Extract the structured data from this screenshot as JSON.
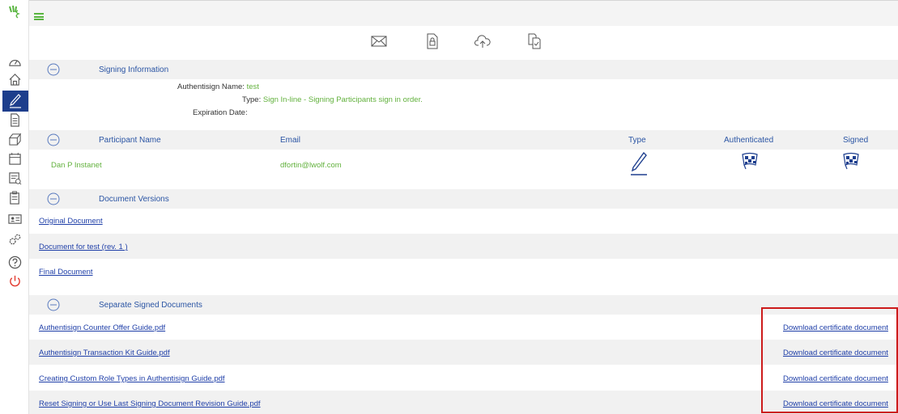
{
  "colors": {
    "accent_green": "#62b13d",
    "link_blue": "#1f3fa8",
    "header_blue": "#2b55a4",
    "nav_active": "#1d3e8c",
    "highlight_red": "#cc1b1b"
  },
  "nav": {
    "icons": [
      "dashboard-icon",
      "home-icon",
      "pen-icon",
      "document-icon",
      "inbox-icon",
      "calendar-icon",
      "search-document-icon",
      "clipboard-icon",
      "contact-card-icon",
      "settings-icon",
      "help-icon",
      "power-icon"
    ]
  },
  "toolbar": {
    "icons": [
      "envelope-icon",
      "locked-document-icon",
      "cloud-upload-icon",
      "copy-document-icon"
    ]
  },
  "signing_info": {
    "title": "Signing Information",
    "name_label": "Authentisign Name:",
    "name_value": "test",
    "type_label": "Type:",
    "type_value": "Sign In-line - Signing Participants sign in order.",
    "expiration_label": "Expiration Date:",
    "expiration_value": ""
  },
  "participants": {
    "headers": {
      "name": "Participant Name",
      "email": "Email",
      "type": "Type",
      "authenticated": "Authenticated",
      "signed": "Signed"
    },
    "rows": [
      {
        "name": "Dan P Instanet",
        "email": "dfortin@lwolf.com",
        "type_icon": "pen-icon",
        "authenticated_icon": "checkered-flag-icon",
        "signed_icon": "checkered-flag-icon"
      }
    ]
  },
  "versions": {
    "title": "Document Versions",
    "items": [
      "Original Document",
      "Document for test (rev. 1 )",
      "Final Document"
    ]
  },
  "separate": {
    "title": "Separate Signed Documents",
    "download_label": "Download certificate document",
    "items": [
      "Authentisign Counter Offer Guide.pdf",
      "Authentisign Transaction Kit Guide.pdf",
      "Creating Custom Role Types in Authentisign Guide.pdf",
      "Reset Signing or Use Last Signing Document Revision Guide.pdf"
    ]
  }
}
